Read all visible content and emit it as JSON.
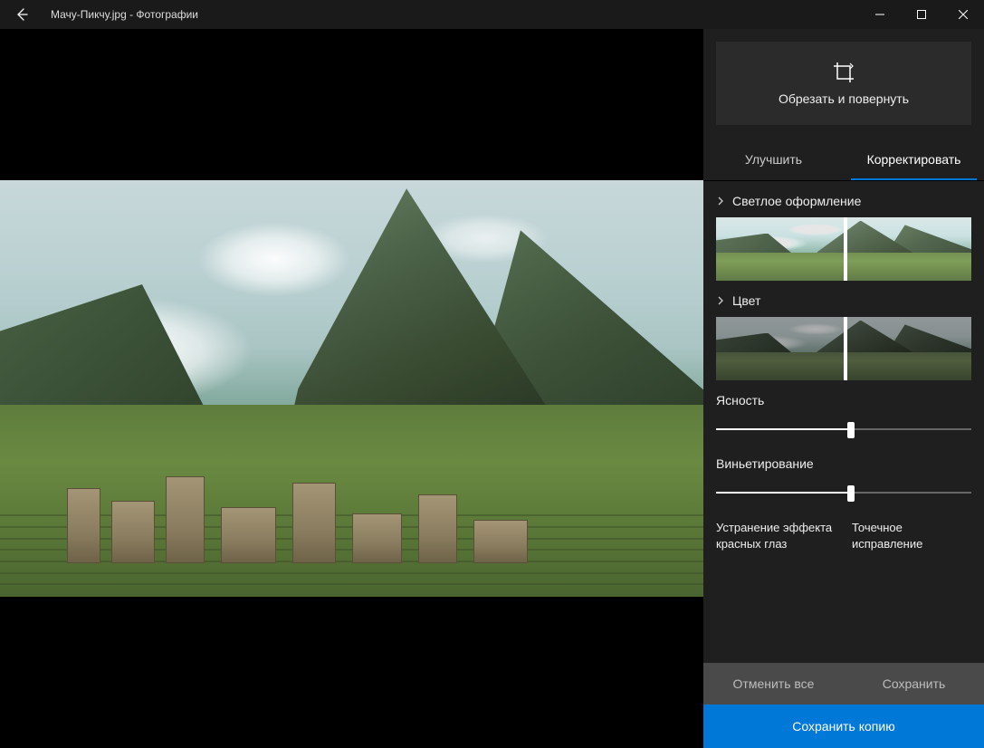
{
  "titlebar": {
    "title": "Мачу-Пикчу.jpg - Фотографии"
  },
  "panel": {
    "crop_rotate_label": "Обрезать и повернуть",
    "tabs": {
      "enhance": "Улучшить",
      "adjust": "Корректировать"
    },
    "sections": {
      "light": "Светлое оформление",
      "color": "Цвет"
    },
    "sliders": {
      "clarity": {
        "label": "Ясность",
        "value_pct": 53
      },
      "vignette": {
        "label": "Виньетирование",
        "value_pct": 53
      }
    },
    "strip_markers": {
      "light_pct": 50,
      "color_pct": 50
    },
    "tools": {
      "red_eye": "Устранение эффекта красных глаз",
      "spot_fix": "Точечное исправление"
    },
    "buttons": {
      "undo_all": "Отменить все",
      "save": "Сохранить",
      "save_copy": "Сохранить копию"
    }
  }
}
